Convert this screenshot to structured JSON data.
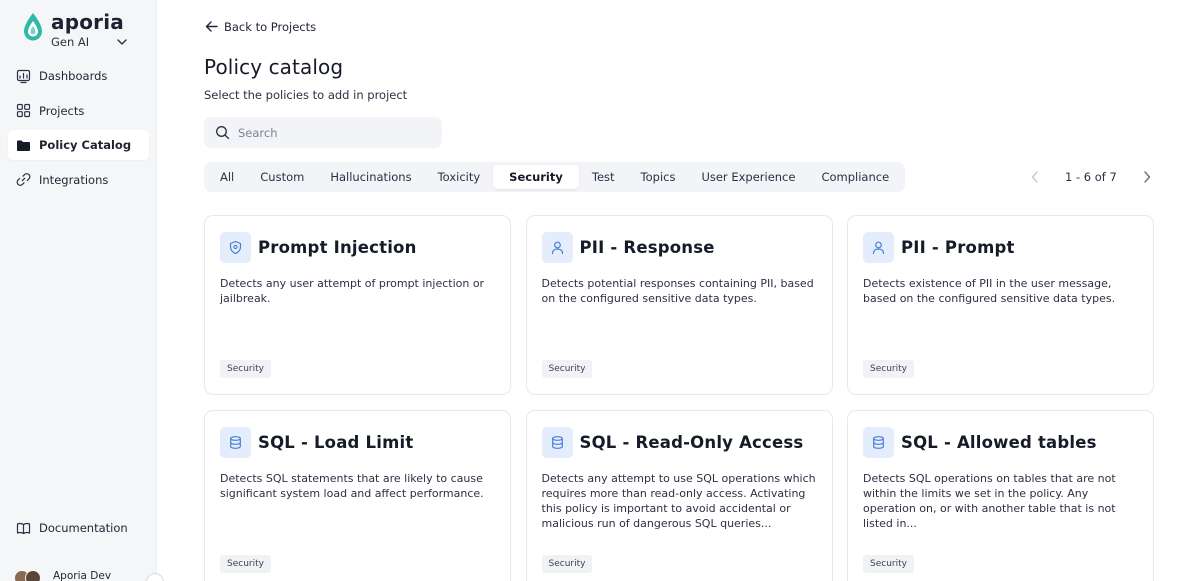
{
  "brand": {
    "name": "aporia",
    "workspace": "Gen AI"
  },
  "sidebar": {
    "items": [
      {
        "label": "Dashboards",
        "icon": "dashboard-icon",
        "active": false
      },
      {
        "label": "Projects",
        "icon": "grid-icon",
        "active": false
      },
      {
        "label": "Policy Catalog",
        "icon": "folder-icon",
        "active": true
      },
      {
        "label": "Integrations",
        "icon": "link-icon",
        "active": false
      }
    ],
    "documentation_label": "Documentation",
    "user_name": "Aporia Dev"
  },
  "header": {
    "back_label": "Back to Projects",
    "title": "Policy catalog",
    "subtitle": "Select the policies to add in project"
  },
  "search": {
    "placeholder": "Search",
    "value": ""
  },
  "tabs": [
    {
      "label": "All",
      "active": false
    },
    {
      "label": "Custom",
      "active": false
    },
    {
      "label": "Hallucinations",
      "active": false
    },
    {
      "label": "Toxicity",
      "active": false
    },
    {
      "label": "Security",
      "active": true
    },
    {
      "label": "Test",
      "active": false
    },
    {
      "label": "Topics",
      "active": false
    },
    {
      "label": "User Experience",
      "active": false
    },
    {
      "label": "Compliance",
      "active": false
    }
  ],
  "pagination": {
    "range_label": "1 - 6 of 7"
  },
  "cards": [
    {
      "title": "Prompt Injection",
      "icon": "shield-icon",
      "description": "Detects any user attempt of prompt injection or jailbreak.",
      "tag": "Security"
    },
    {
      "title": "PII - Response",
      "icon": "user-icon",
      "description": "Detects potential responses containing PII, based on the configured sensitive data types.",
      "tag": "Security"
    },
    {
      "title": "PII - Prompt",
      "icon": "user-icon",
      "description": "Detects existence of PII in the user message, based on the configured sensitive data types.",
      "tag": "Security"
    },
    {
      "title": "SQL - Load Limit",
      "icon": "database-icon",
      "description": "Detects SQL statements that are likely to cause significant system load and affect performance.",
      "tag": "Security"
    },
    {
      "title": "SQL - Read-Only Access",
      "icon": "database-icon",
      "description": "Detects any attempt to use SQL operations which requires more than read-only access. Activating this policy is important to avoid accidental or malicious run of dangerous SQL queries...",
      "tag": "Security"
    },
    {
      "title": "SQL - Allowed tables",
      "icon": "database-icon",
      "description": "Detects SQL operations on tables that are not within the limits we set in the policy. Any operation on, or with another table that is not listed in...",
      "tag": "Security"
    }
  ],
  "colors": {
    "brand_teal": "#2fb9a6",
    "accent_blue": "#4a7fd4",
    "icon_bg": "#e3edfb"
  }
}
